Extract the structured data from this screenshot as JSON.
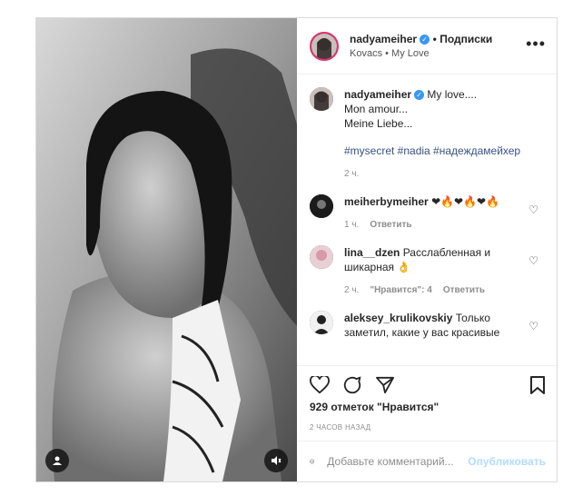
{
  "header": {
    "username": "nadyameiher",
    "follow_label": "• Подписки",
    "subtitle": "Kovacs • My Love"
  },
  "caption": {
    "username": "nadyameiher",
    "line1": "My love....",
    "line2": "Mon amour...",
    "line3": "Meine Liebe...",
    "hashtags": "#mysecret #nadia #надеждамейхер",
    "age": "2 ч."
  },
  "comments": [
    {
      "username": "meiherbymeiher",
      "text": "❤🔥❤🔥❤🔥",
      "age": "1 ч.",
      "reply_label": "Ответить",
      "likes_label": ""
    },
    {
      "username": "lina__dzen",
      "text": "Расслабленная и шикарная 👌",
      "age": "2 ч.",
      "reply_label": "Ответить",
      "likes_label": "\"Нравится\": 4"
    },
    {
      "username": "aleksey_krulikovskiy",
      "text": "Только заметил, какие у вас красивые",
      "age": "",
      "reply_label": "",
      "likes_label": ""
    }
  ],
  "post": {
    "likes": "929 отметок \"Нравится\"",
    "time": "2 часов назад"
  },
  "composer": {
    "placeholder": "Добавьте комментарий...",
    "publish_label": "Опубликовать"
  },
  "icons": {
    "like": "heart-icon",
    "comment": "comment-icon",
    "share": "send-icon",
    "save": "bookmark-icon",
    "more": "more-icon",
    "emoji": "emoji-icon",
    "tag": "user-tag-icon",
    "mute": "speaker-icon",
    "verified": "verified-badge-icon"
  },
  "colors": {
    "accent": "#3897f0",
    "publish_disabled": "#b3dbff",
    "hashtag": "#385185"
  }
}
